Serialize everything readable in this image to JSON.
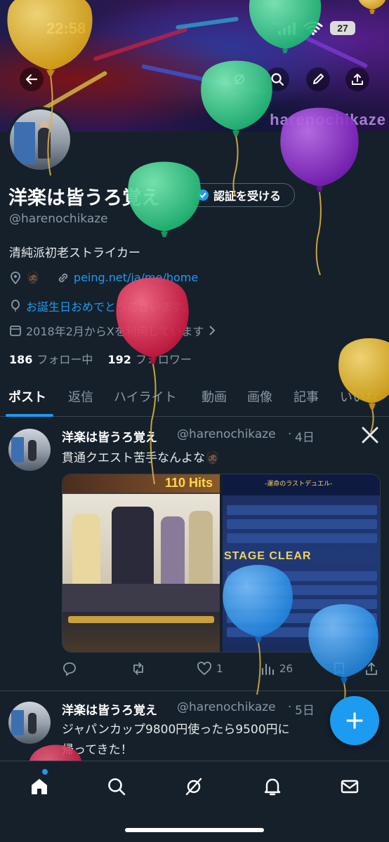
{
  "status_bar": {
    "time": "22:58",
    "battery": "27"
  },
  "banner": {
    "watermark": "harenochikaze"
  },
  "profile": {
    "display_name": "洋楽は皆うろ覚え",
    "verify_label": "認証を受ける",
    "handle": "@harenochikaze",
    "bio": "清純派初老ストライカー",
    "location_emoji": "🧔🏿",
    "link": "peing.net/ja/me/home",
    "birthday": "お誕生日おめでとうございます。",
    "joined": "2018年2月からXを利用しています",
    "following_count": "186",
    "following_label": "フォロー中",
    "followers_count": "192",
    "followers_label": "フォロワー"
  },
  "tabs": [
    "ポスト",
    "返信",
    "ハイライト",
    "動画",
    "画像",
    "記事",
    "いいね"
  ],
  "tweets": [
    {
      "name": "洋楽は皆うろ覚え",
      "handle": "@harenochikaze",
      "time": "4日",
      "text": "貫通クエスト苦手なんよな🧔🏿",
      "media_left_hits": "110 Hits",
      "media_right_title": "-運命のラストデュエル-",
      "media_right_clear": "STAGE CLEAR",
      "likes": "1",
      "views": "26"
    },
    {
      "name": "洋楽は皆うろ覚え",
      "handle": "@harenochikaze",
      "time": "5日",
      "text_line1": "ジャパンカップ9800円使ったら9500円に",
      "text_line2": "帰ってきた！"
    }
  ],
  "colors": {
    "background": "#15202b",
    "accent": "#1d9bf0",
    "secondary_text": "#8b98a5",
    "balloon_yellow": "#e8b820",
    "balloon_green": "#2ed48a",
    "balloon_purple": "#8e2ac9",
    "balloon_red": "#e0294f",
    "balloon_blue": "#2e9cf0"
  },
  "icons": {
    "back": "arrow-left-icon",
    "search": "search-icon",
    "grok": "grok-icon",
    "edit": "pencil-icon",
    "share": "share-icon",
    "compose": "plus-icon"
  }
}
